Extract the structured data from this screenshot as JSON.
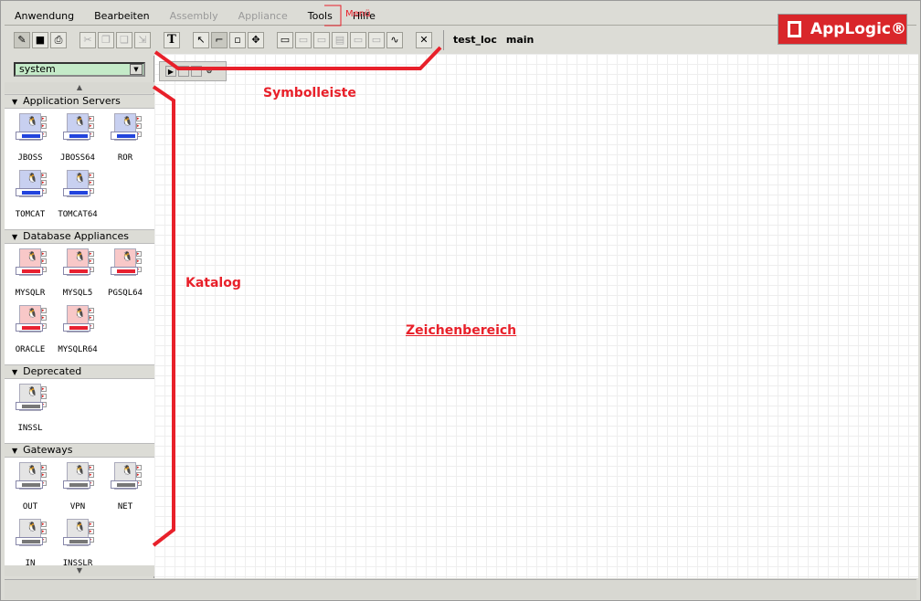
{
  "menu": [
    "Anwendung",
    "Bearbeiten",
    "Assembly",
    "Appliance",
    "Tools",
    "Hilfe"
  ],
  "menu_disabled": [
    false,
    false,
    true,
    true,
    false,
    false
  ],
  "toolbar": {
    "context_app": "test_loc",
    "context_assembly": "main"
  },
  "logo": "AppLogic®",
  "catalog": {
    "selected": "system",
    "sections": [
      {
        "title": "Application Servers",
        "color": "blue",
        "items": [
          "JBOSS",
          "JBOSS64",
          "ROR",
          "TOMCAT",
          "TOMCAT64"
        ]
      },
      {
        "title": "Database Appliances",
        "color": "red",
        "items": [
          "MYSQLR",
          "MYSQL5",
          "PGSQL64",
          "ORACLE",
          "MYSQLR64"
        ]
      },
      {
        "title": "Deprecated",
        "color": "gray",
        "items": [
          "INSSL"
        ]
      },
      {
        "title": "Gateways",
        "color": "gray",
        "items": [
          "OUT",
          "VPN",
          "NET",
          "IN",
          "INSSLR"
        ]
      }
    ]
  },
  "annotations": {
    "menu": "Menü",
    "toolbar": "Symbolleiste",
    "catalog": "Katalog",
    "canvas": "Zeichenbereich"
  },
  "colors": {
    "annotation": "#e8202a",
    "logo": "#d9262a"
  }
}
